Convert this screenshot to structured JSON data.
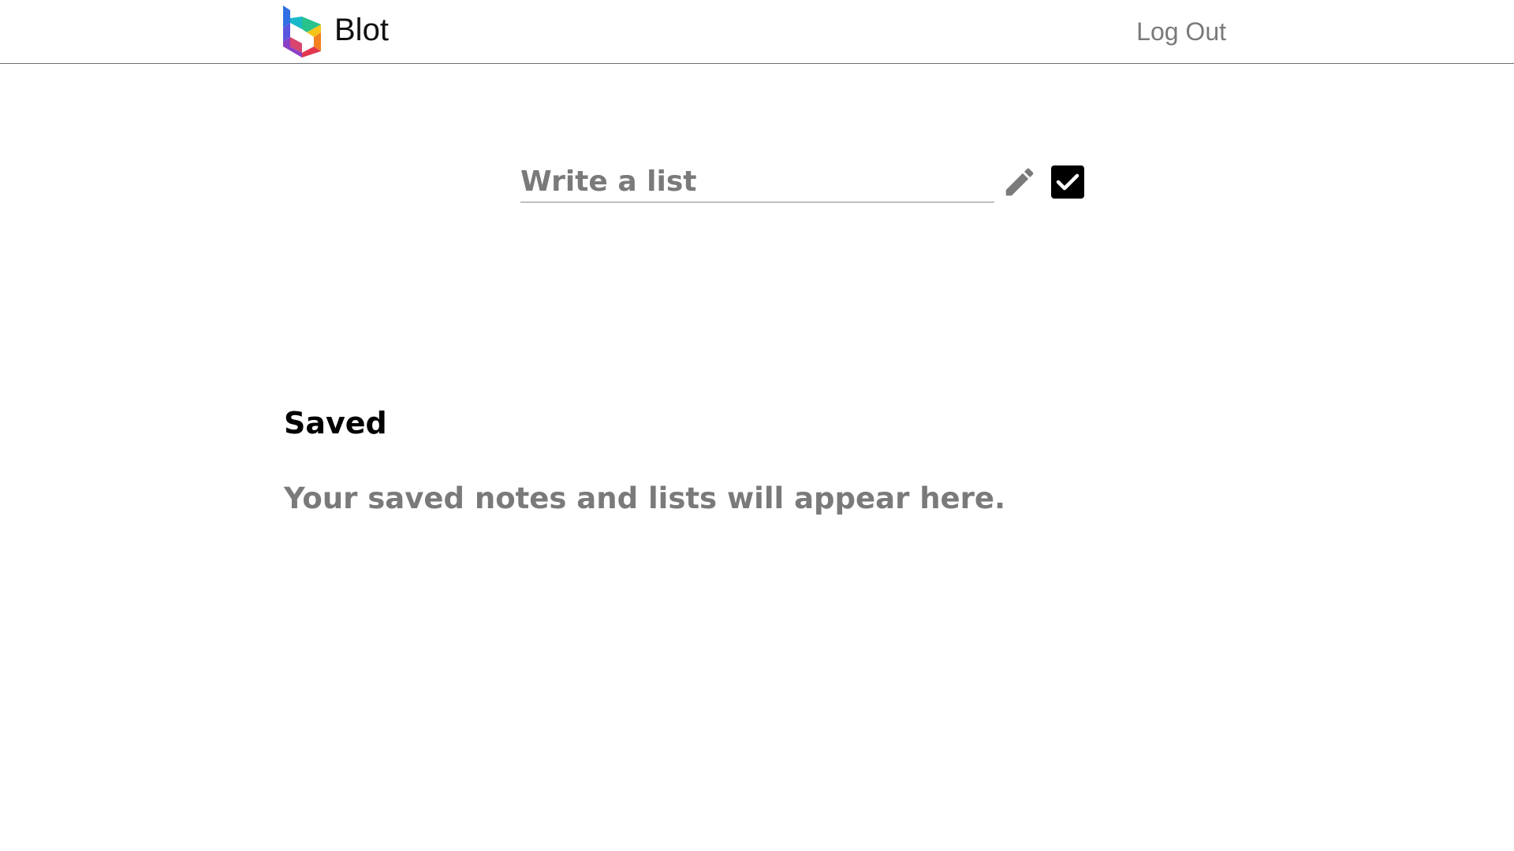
{
  "header": {
    "brand_name": "Blot",
    "logo_icon": "blot-logo-icon",
    "logout_label": "Log Out"
  },
  "composer": {
    "input_value": "",
    "input_placeholder": "Write a list",
    "edit_icon": "pencil-icon",
    "list_mode_icon": "checkbox-checked-icon"
  },
  "saved": {
    "title": "Saved",
    "empty_message": "Your saved notes and lists will appear here."
  },
  "colors": {
    "text_primary": "#000000",
    "text_muted": "#7a7a7a",
    "divider": "#6e6e6e",
    "logo_blue": "#2f6fe3",
    "logo_teal": "#19b9c9",
    "logo_green": "#28c28a",
    "logo_yellow": "#f5c51c",
    "logo_orange": "#f4801f",
    "logo_red": "#e2374f",
    "logo_purple": "#8a3fc4"
  }
}
